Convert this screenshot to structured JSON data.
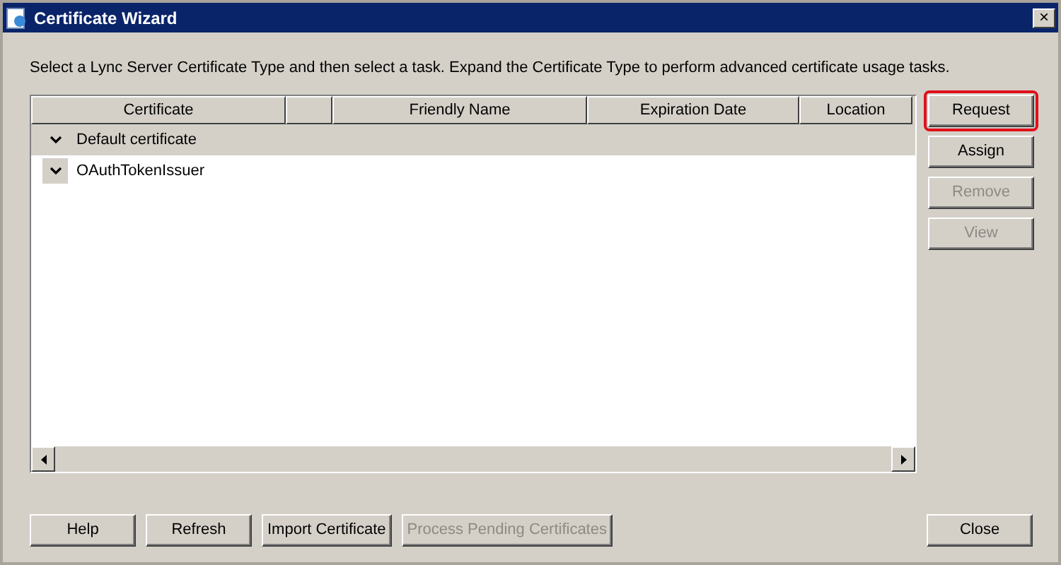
{
  "window": {
    "title": "Certificate Wizard",
    "close": "×"
  },
  "instruction": "Select a Lync Server Certificate Type and then select a task. Expand the Certificate Type to perform advanced certificate usage tasks.",
  "table": {
    "columns": [
      "Certificate",
      "",
      "Friendly Name",
      "Expiration Date",
      "Location"
    ],
    "rows": [
      {
        "label": "Default certificate",
        "selected": true,
        "expanded": true
      },
      {
        "label": "OAuthTokenIssuer",
        "selected": false,
        "expanded": true
      }
    ]
  },
  "side_buttons": [
    {
      "label": "Request",
      "disabled": false,
      "highlighted": true
    },
    {
      "label": "Assign",
      "disabled": false,
      "highlighted": false
    },
    {
      "label": "Remove",
      "disabled": true,
      "highlighted": false
    },
    {
      "label": "View",
      "disabled": true,
      "highlighted": false
    }
  ],
  "bottom_buttons": [
    {
      "label": "Help",
      "disabled": false
    },
    {
      "label": "Refresh",
      "disabled": false
    },
    {
      "label": "Import Certificate",
      "disabled": false
    },
    {
      "label": "Process Pending Certificates",
      "disabled": true
    }
  ],
  "close_button": {
    "label": "Close",
    "disabled": false
  }
}
